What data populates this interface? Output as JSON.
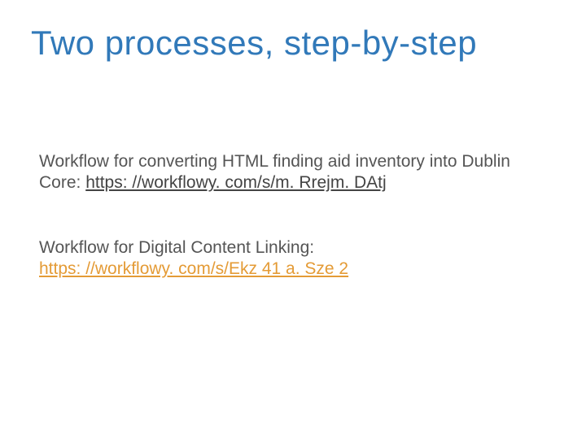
{
  "title": "Two processes, step-by-step",
  "para1_prefix": "Workflow for converting HTML finding aid inventory into Dublin Core: ",
  "para1_link": "https: //workflowy. com/s/m. Rrejm. DAtj",
  "para2_prefix": "Workflow for Digital Content Linking: ",
  "para2_link": "https: //workflowy. com/s/Ekz 41 a. Sze 2"
}
